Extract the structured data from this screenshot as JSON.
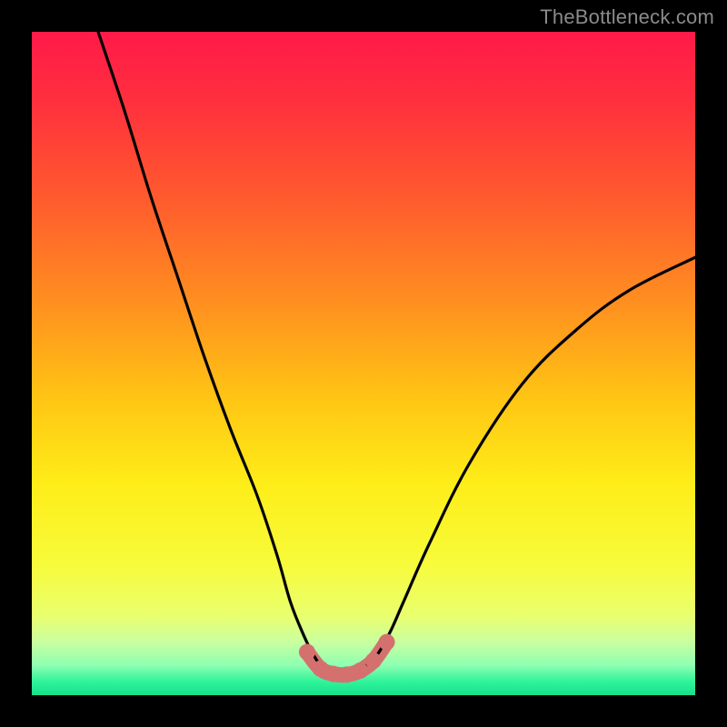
{
  "watermark": "TheBottleneck.com",
  "colors": {
    "background": "#000000",
    "gradient_stops": [
      {
        "offset": 0.0,
        "color": "#ff1a49"
      },
      {
        "offset": 0.1,
        "color": "#ff2e3e"
      },
      {
        "offset": 0.25,
        "color": "#ff5a2e"
      },
      {
        "offset": 0.4,
        "color": "#ff8c20"
      },
      {
        "offset": 0.55,
        "color": "#ffc414"
      },
      {
        "offset": 0.68,
        "color": "#feed18"
      },
      {
        "offset": 0.8,
        "color": "#f7fb3a"
      },
      {
        "offset": 0.88,
        "color": "#eaff6e"
      },
      {
        "offset": 0.92,
        "color": "#c9ffa0"
      },
      {
        "offset": 0.955,
        "color": "#8effb2"
      },
      {
        "offset": 0.98,
        "color": "#2ef39a"
      },
      {
        "offset": 1.0,
        "color": "#17e08a"
      }
    ],
    "curve": "#000000",
    "marker": "#d4716f"
  },
  "chart_data": {
    "type": "line",
    "title": "",
    "xlabel": "",
    "ylabel": "",
    "xlim": [
      0,
      100
    ],
    "ylim": [
      0,
      100
    ],
    "grid": false,
    "legend": false,
    "series": [
      {
        "name": "curve",
        "x": [
          10,
          14,
          18,
          22,
          26,
          30,
          34,
          37,
          39,
          41,
          42.5,
          44,
          46,
          48,
          50,
          52,
          54,
          56,
          60,
          66,
          74,
          82,
          90,
          100
        ],
        "y": [
          100,
          88,
          75,
          63,
          51,
          40,
          30,
          21,
          14,
          9,
          6,
          4,
          3.2,
          3.3,
          4.2,
          6,
          9.5,
          14,
          23,
          35,
          47,
          55,
          61,
          66
        ]
      },
      {
        "name": "markers",
        "x": [
          41.5,
          43.5,
          45.5,
          47.5,
          49.5,
          51.5,
          53.5
        ],
        "y": [
          6.5,
          4.0,
          3.2,
          3.1,
          3.7,
          5.2,
          8.0
        ]
      }
    ],
    "annotations": [
      {
        "text": "TheBottleneck.com",
        "position": "top-right"
      }
    ]
  }
}
